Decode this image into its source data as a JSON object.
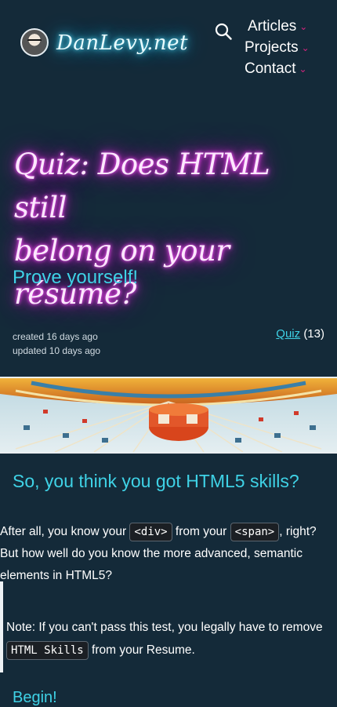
{
  "header": {
    "brand": "DanLevy.net",
    "nav": [
      {
        "label": "Articles"
      },
      {
        "label": "Projects"
      },
      {
        "label": "Contact"
      }
    ]
  },
  "hero": {
    "title_line1": "Quiz: Does HTML still",
    "title_line2": "belong on your résumé?",
    "subtitle": "Prove yourself!"
  },
  "meta": {
    "created": "created 16 days ago",
    "updated": "updated 10 days ago",
    "tag_label": "Quiz",
    "tag_count": "(13)"
  },
  "content": {
    "section_title": "So, you think you got HTML5 skills?",
    "p1_a": "After all, you know your ",
    "code_div": "<div>",
    "p1_b": " from your ",
    "code_span": "<span>",
    "p1_c": ", right?",
    "p1_d": "But how well do you know the more advanced, semantic elements in HTML5?",
    "note_a": "Note: If you can't pass this test, you legally have to remove ",
    "code_skills": "HTML Skills",
    "note_b": " from your Resume.",
    "begin": "Begin!"
  },
  "colors": {
    "background": "#142a39",
    "accent_cyan": "#3fd2e6",
    "neon_pink": "#e02de0",
    "chevron": "#d7247f"
  }
}
